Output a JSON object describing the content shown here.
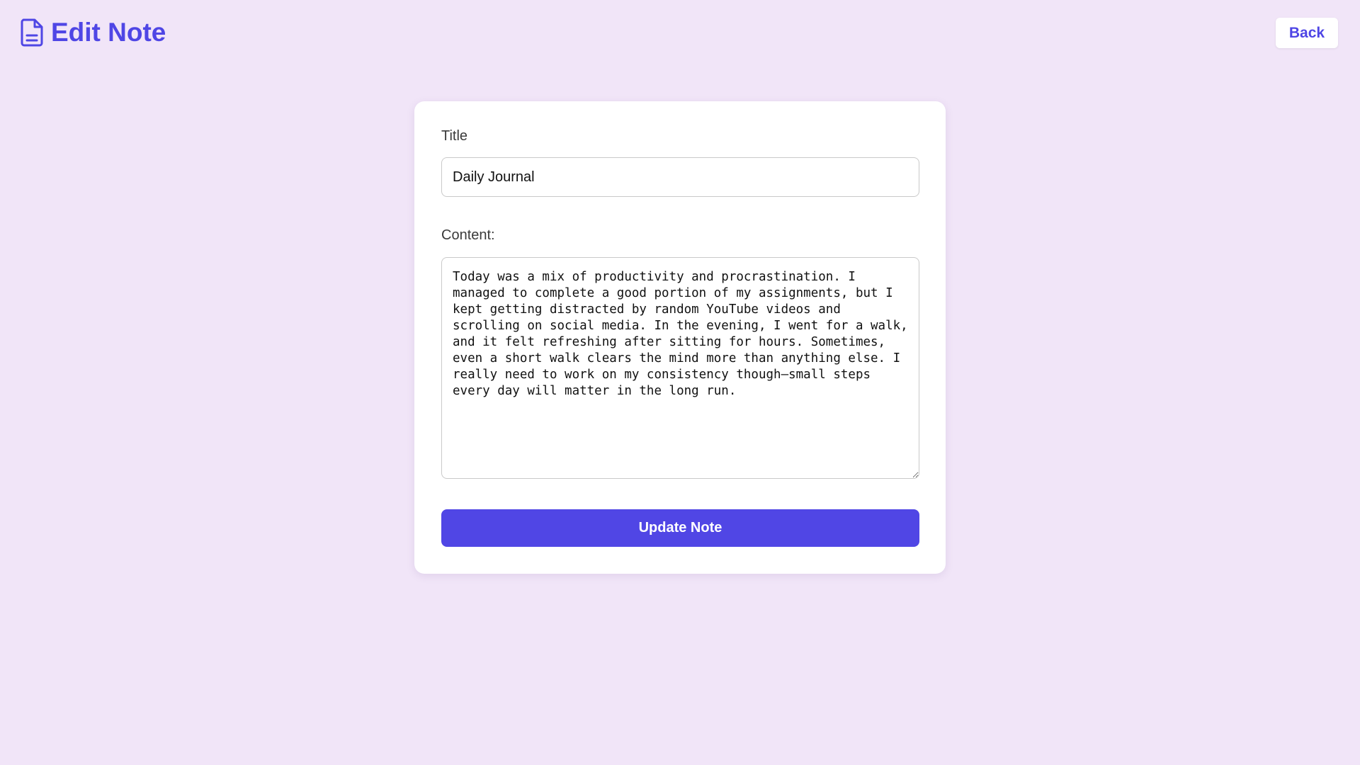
{
  "header": {
    "title": "Edit Note",
    "icon": "document-icon",
    "back_label": "Back"
  },
  "form": {
    "title_label": "Title",
    "title_value": "Daily Journal",
    "content_label": "Content:",
    "content_value": "Today was a mix of productivity and procrastination. I managed to complete a good portion of my assignments, but I kept getting distracted by random YouTube videos and scrolling on social media. In the evening, I went for a walk, and it felt refreshing after sitting for hours. Sometimes, even a short walk clears the mind more than anything else. I really need to work on my consistency though—small steps every day will matter in the long run.",
    "submit_label": "Update Note"
  },
  "colors": {
    "background": "#f1e5f8",
    "accent": "#4f46e5",
    "card": "#ffffff"
  }
}
